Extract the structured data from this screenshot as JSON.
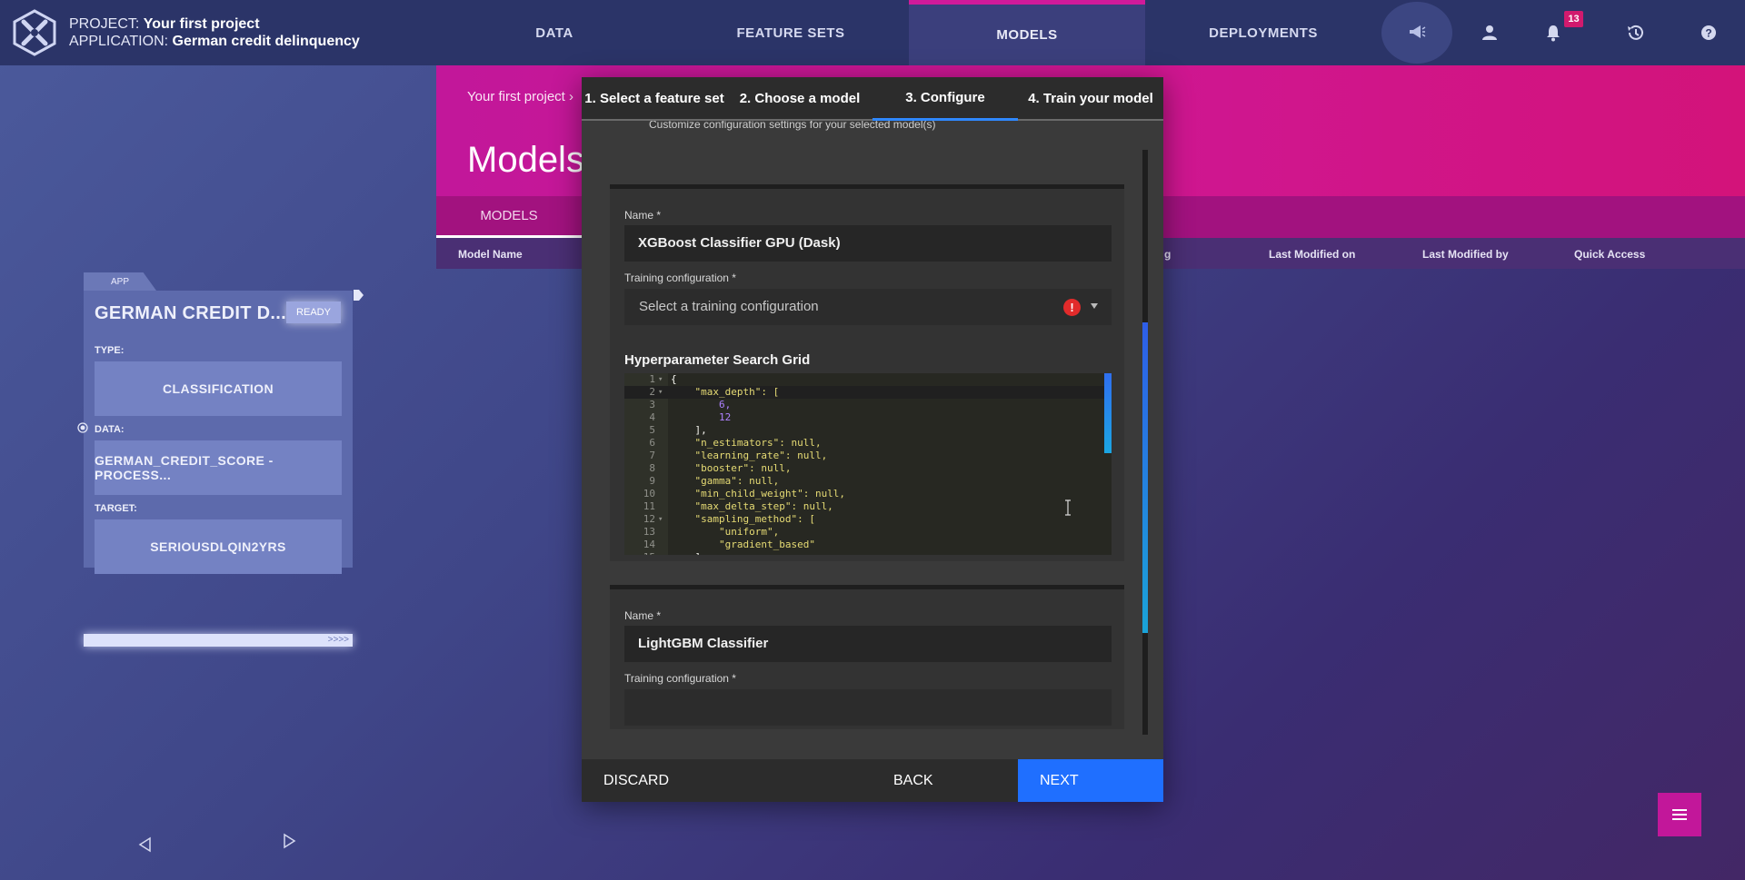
{
  "header": {
    "project_label": "PROJECT:",
    "project_name": "Your first project",
    "application_label": "APPLICATION:",
    "application_name": "German credit delinquency",
    "nav": [
      "DATA",
      "FEATURE SETS",
      "MODELS",
      "DEPLOYMENTS"
    ],
    "active_nav": "MODELS",
    "notification_count": "13",
    "icons": [
      "announcement-icon",
      "user-icon",
      "bell-icon",
      "history-icon",
      "help-icon"
    ]
  },
  "app_card": {
    "tag": "APP",
    "title": "GERMAN CREDIT D...",
    "status": "READY",
    "type_label": "TYPE:",
    "type_value": "CLASSIFICATION",
    "data_label": "DATA:",
    "data_value": "GERMAN_CREDIT_SCORE - PROCESS...",
    "target_label": "TARGET:",
    "target_value": "SERIOUSDLQIN2YRS",
    "progress_text": ">>>>"
  },
  "main": {
    "breadcrumb": "Your first project",
    "page_title": "Models",
    "tab": "MODELS",
    "columns": [
      "Model Name",
      "g",
      "Last Modified on",
      "Last Modified by",
      "Quick Access"
    ]
  },
  "modal": {
    "steps": [
      "1. Select a feature set",
      "2. Choose a model",
      "3. Configure",
      "4. Train your model"
    ],
    "active_step": 2,
    "customize_text": "Customize configuration settings for your selected model(s)",
    "models": [
      {
        "name_label": "Name *",
        "name_value": "XGBoost Classifier GPU (Dask)",
        "training_label": "Training configuration *",
        "training_placeholder": "Select a training configuration",
        "grid_title": "Hyperparameter Search Grid",
        "code_lines": [
          "{",
          "    \"max_depth\": [",
          "        6,",
          "        12",
          "    ],",
          "    \"n_estimators\": null,",
          "    \"learning_rate\": null,",
          "    \"booster\": null,",
          "    \"gamma\": null,",
          "    \"min_child_weight\": null,",
          "    \"max_delta_step\": null,",
          "    \"sampling_method\": [",
          "        \"uniform\",",
          "        \"gradient_based\"",
          "    ],"
        ]
      },
      {
        "name_label": "Name *",
        "name_value": "LightGBM Classifier",
        "training_label": "Training configuration *"
      }
    ],
    "footer": {
      "discard": "DISCARD",
      "back": "BACK",
      "next": "NEXT"
    }
  },
  "colors": {
    "accent_magenta": "#c2179a",
    "primary_blue": "#1f6fff",
    "error_red": "#e22b2b"
  }
}
